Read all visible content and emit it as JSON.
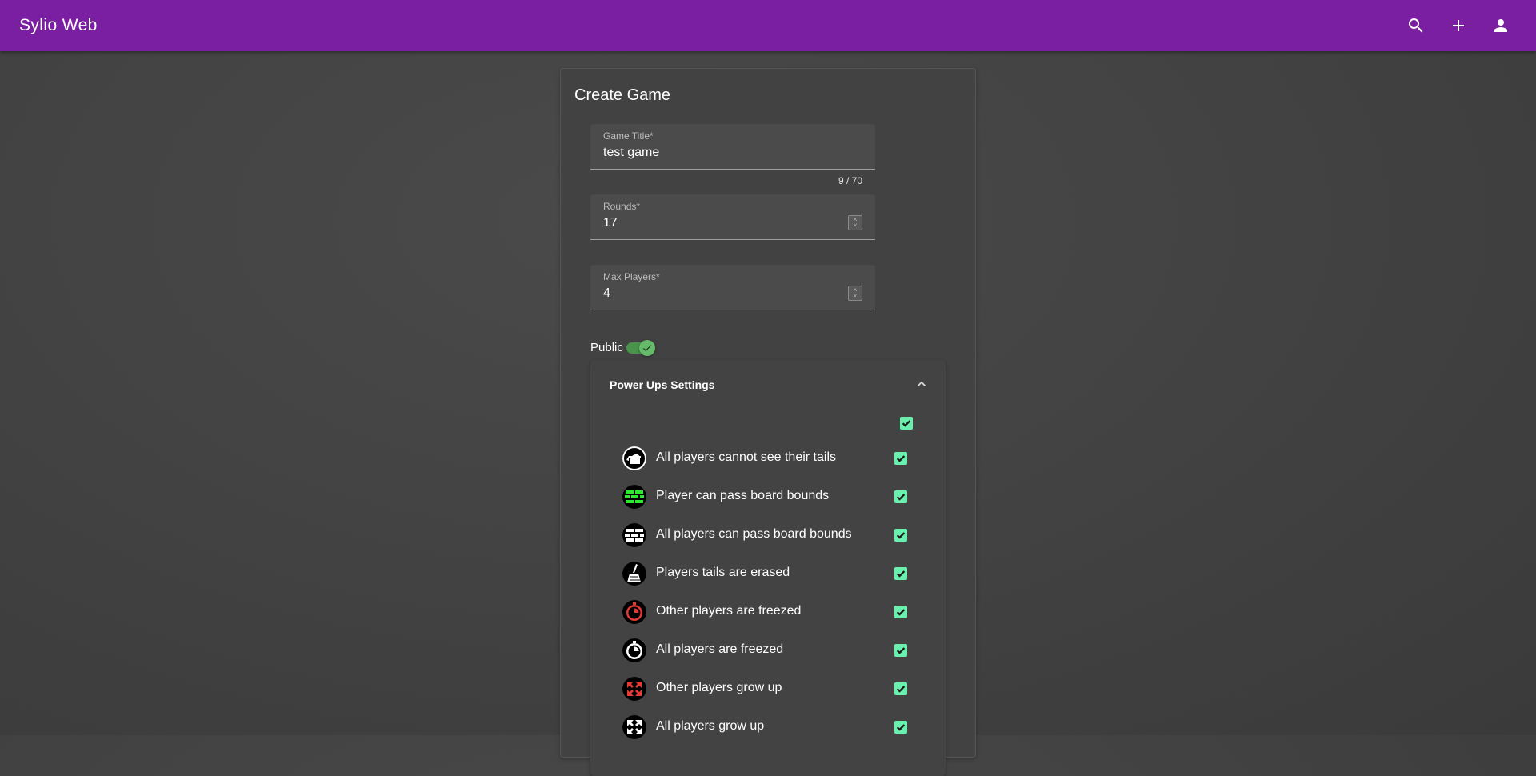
{
  "app": {
    "title": "Sylio Web"
  },
  "toolbar": {
    "icons": [
      "search-icon",
      "add-icon",
      "account-icon"
    ]
  },
  "form": {
    "title": "Create Game",
    "game_title": {
      "label": "Game Title*",
      "value": "test game",
      "counter": "9 / 70"
    },
    "rounds": {
      "label": "Rounds*",
      "value": "17"
    },
    "max_players": {
      "label": "Max Players*",
      "value": "4"
    },
    "public": {
      "label": "Public",
      "checked": true
    }
  },
  "power_ups": {
    "title": "Power Ups Settings",
    "expanded": true,
    "select_all_checked": true,
    "items": [
      {
        "label": "All players cannot see their tails",
        "icon": "blindfold-icon",
        "checked": true
      },
      {
        "label": "Player can pass board bounds",
        "icon": "green-wall-icon",
        "checked": true
      },
      {
        "label": "All players can pass board bounds",
        "icon": "white-wall-icon",
        "checked": true
      },
      {
        "label": "Players tails are erased",
        "icon": "broom-icon",
        "checked": true
      },
      {
        "label": "Other players are freezed",
        "icon": "red-stopwatch-icon",
        "checked": true
      },
      {
        "label": "All players are freezed",
        "icon": "white-stopwatch-icon",
        "checked": true
      },
      {
        "label": "Other players grow up",
        "icon": "red-expand-icon",
        "checked": true
      },
      {
        "label": "All players grow up",
        "icon": "white-expand-icon",
        "checked": true
      }
    ]
  },
  "colors": {
    "toolbar": "#7b1fa2",
    "accent_checkbox": "#69f0ae",
    "toggle": "#4caf50"
  }
}
